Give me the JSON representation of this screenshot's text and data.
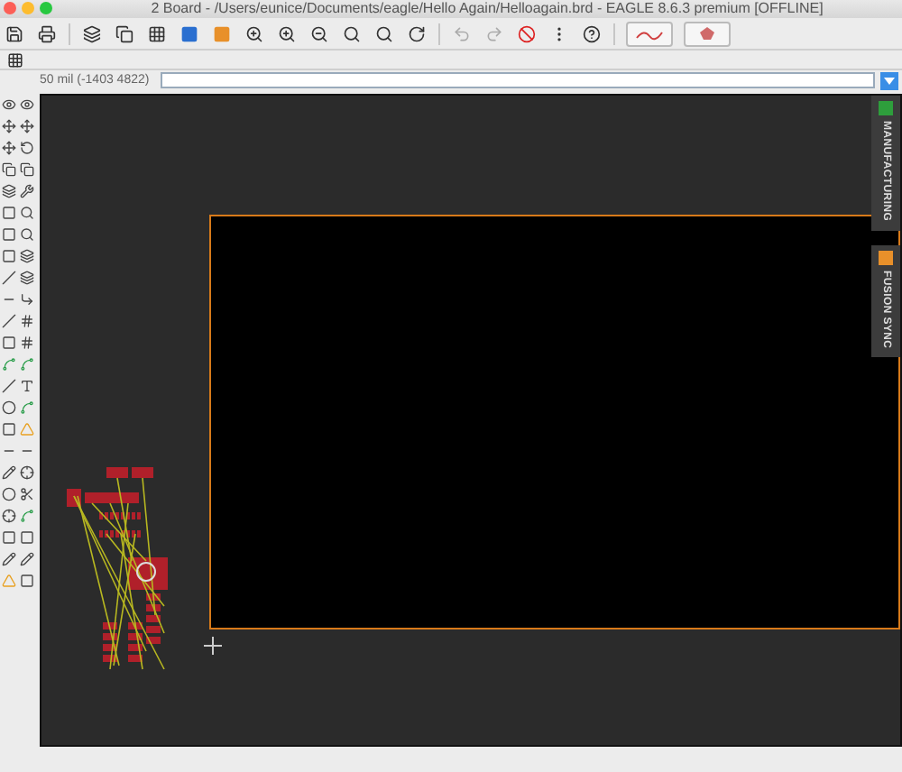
{
  "window": {
    "title": "2 Board - /Users/eunice/Documents/eagle/Hello Again/Helloagain.brd - EAGLE 8.6.3 premium [OFFLINE]"
  },
  "coordinates": "50 mil (-1403 4822)",
  "side_tabs": [
    {
      "label": "MANUFACTURING",
      "color": "#2e9e3c"
    },
    {
      "label": "FUSION SYNC",
      "color": "#e8902a"
    }
  ]
}
